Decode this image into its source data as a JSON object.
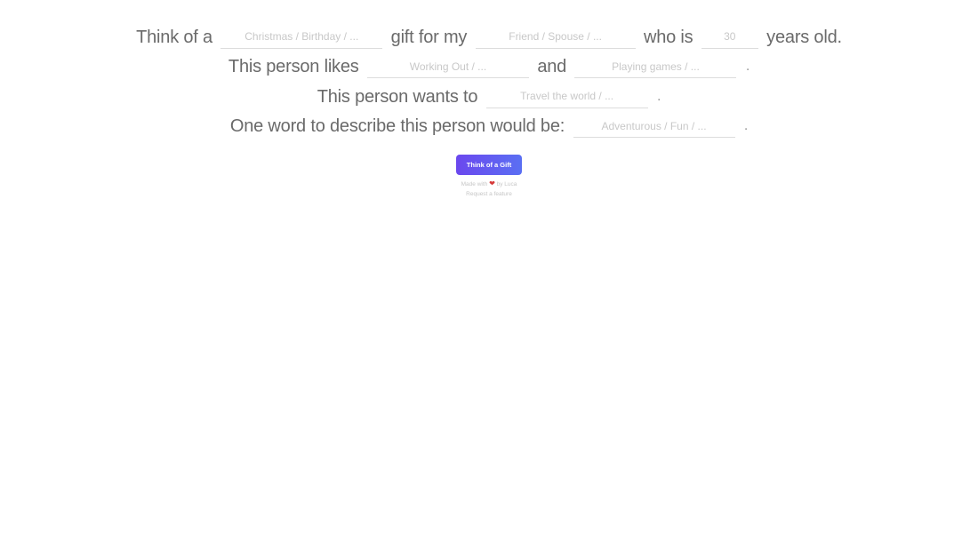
{
  "form": {
    "line1": {
      "prefix": "Think of a",
      "occasion_placeholder": "Christmas / Birthday / ...",
      "occasion_value": "",
      "middle": "gift for my",
      "relation_placeholder": "Friend / Spouse / ...",
      "relation_value": "",
      "age_label": "who is",
      "age_placeholder": "30",
      "age_value": "",
      "suffix": "years old."
    },
    "line2": {
      "prefix": "This person likes",
      "like1_placeholder": "Working Out / ...",
      "like1_value": "",
      "middle": "and",
      "like2_placeholder": "Playing games / ...",
      "like2_value": "",
      "suffix": "."
    },
    "line3": {
      "prefix": "This person wants to",
      "want_placeholder": "Travel the world / ...",
      "want_value": "",
      "suffix": "."
    },
    "line4": {
      "prefix": "One word to describe this person would be:",
      "word_placeholder": "Adventurous / Fun / ...",
      "word_value": "",
      "suffix": "."
    }
  },
  "submit": {
    "label": "Think of a Gift"
  },
  "footer": {
    "made_with_prefix": "Made with",
    "heart_icon": "heart-icon",
    "made_with_suffix": "by Luca",
    "request_link": "Request a feature"
  },
  "colors": {
    "button_gradient_start": "#6b48ee",
    "button_gradient_end": "#5a6ff3",
    "heart": "#d63a3a"
  }
}
